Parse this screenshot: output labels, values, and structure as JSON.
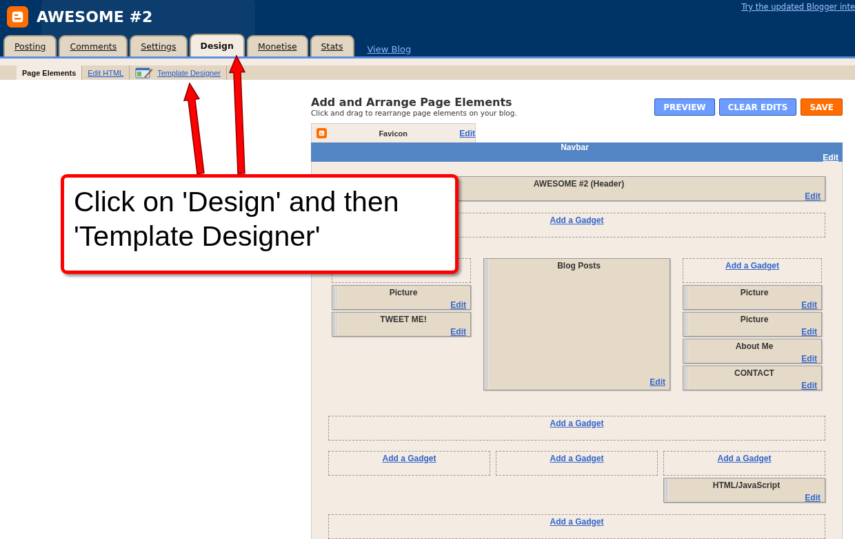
{
  "header": {
    "blog_title": "AWESOME #2",
    "top_link": "Try the updated Blogger inte"
  },
  "tabs": [
    {
      "label": "Posting",
      "selected": false
    },
    {
      "label": "Comments",
      "selected": false
    },
    {
      "label": "Settings",
      "selected": false
    },
    {
      "label": "Design",
      "selected": true
    },
    {
      "label": "Monetise",
      "selected": false
    },
    {
      "label": "Stats",
      "selected": false
    }
  ],
  "view_blog": "View Blog",
  "subnav": [
    {
      "label": "Page Elements",
      "selected": true,
      "kind": "plain"
    },
    {
      "label": "Edit HTML",
      "selected": false,
      "kind": "plain"
    },
    {
      "label": "Template Designer",
      "selected": false,
      "kind": "with_icon"
    }
  ],
  "editor": {
    "title": "Add and Arrange Page Elements",
    "subtitle": "Click and drag to rearrange page elements on your blog.",
    "buttons": [
      {
        "label": "PREVIEW",
        "kind": "blue"
      },
      {
        "label": "CLEAR EDITS",
        "kind": "blue"
      },
      {
        "label": "SAVE",
        "kind": "orange"
      }
    ],
    "favicon": {
      "label": "Favicon",
      "edit": "Edit"
    },
    "navbar": {
      "label": "Navbar",
      "edit": "Edit"
    },
    "sections": [
      {
        "kind": "full",
        "columns": [
          [
            {
              "kind": "widget",
              "title": "AWESOME #2 (Header)",
              "edit": "Edit"
            }
          ]
        ]
      },
      {
        "kind": "full",
        "columns": [
          [
            {
              "kind": "add",
              "label": "Add a Gadget"
            }
          ]
        ]
      },
      {
        "kind": "main",
        "columns": [
          [
            {
              "kind": "add"
            },
            {
              "kind": "widget",
              "title": "Picture",
              "edit": "Edit"
            },
            {
              "kind": "widget",
              "title": "TWEET ME!",
              "edit": "Edit"
            }
          ],
          [
            {
              "kind": "posts",
              "title": "Blog Posts",
              "edit": "Edit"
            }
          ],
          [
            {
              "kind": "add",
              "label": "Add a Gadget"
            },
            {
              "kind": "widget",
              "title": "Picture",
              "edit": "Edit"
            },
            {
              "kind": "widget",
              "title": "Picture",
              "edit": "Edit"
            },
            {
              "kind": "widget",
              "title": "About Me",
              "edit": "Edit"
            },
            {
              "kind": "widget",
              "title": "CONTACT",
              "edit": "Edit"
            }
          ]
        ]
      },
      {
        "kind": "full",
        "columns": [
          [
            {
              "kind": "add",
              "label": "Add a Gadget"
            }
          ]
        ]
      },
      {
        "kind": "equal",
        "columns": [
          [
            {
              "kind": "add",
              "label": "Add a Gadget"
            }
          ],
          [
            {
              "kind": "add",
              "label": "Add a Gadget"
            }
          ],
          [
            {
              "kind": "add",
              "label": "Add a Gadget"
            },
            {
              "kind": "widget",
              "title": "HTML/JavaScript",
              "edit": "Edit"
            }
          ]
        ]
      },
      {
        "kind": "full",
        "columns": [
          [
            {
              "kind": "add",
              "label": "Add a Gadget"
            }
          ]
        ]
      }
    ]
  },
  "callout": {
    "text": "Click on 'Design' and then 'Template Designer'"
  }
}
